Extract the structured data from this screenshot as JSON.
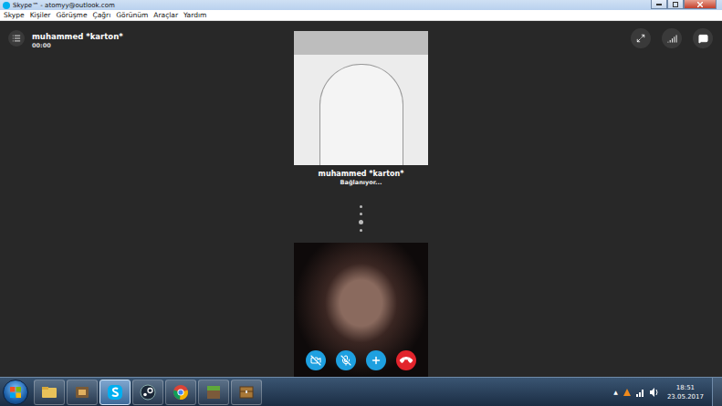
{
  "window": {
    "title": "Skype™ - atomyy@outlook.com"
  },
  "menu": [
    "Skype",
    "Kişiler",
    "Görüşme",
    "Çağrı",
    "Görünüm",
    "Araçlar",
    "Yardım"
  ],
  "call": {
    "contact": "muhammed *karton*",
    "duration": "00:00",
    "status": "Bağlanıyor..."
  },
  "controls": [
    {
      "kind": "video",
      "on": false,
      "color": "#1ea0e0"
    },
    {
      "kind": "mic",
      "on": false,
      "color": "#1ea0e0"
    },
    {
      "kind": "add",
      "color": "#1ea0e0"
    },
    {
      "kind": "hangup",
      "color": "#e2242c"
    }
  ],
  "taskbar": {
    "apps": [
      {
        "kind": "explorer",
        "selected": false
      },
      {
        "kind": "media",
        "selected": false
      },
      {
        "kind": "skype",
        "selected": true
      },
      {
        "kind": "steam",
        "selected": false
      },
      {
        "kind": "chrome",
        "selected": false
      },
      {
        "kind": "minecraft",
        "selected": false
      },
      {
        "kind": "chest",
        "selected": false
      }
    ],
    "tray_arrow": "▲",
    "time": "18:51",
    "date": "23.05.2017"
  }
}
